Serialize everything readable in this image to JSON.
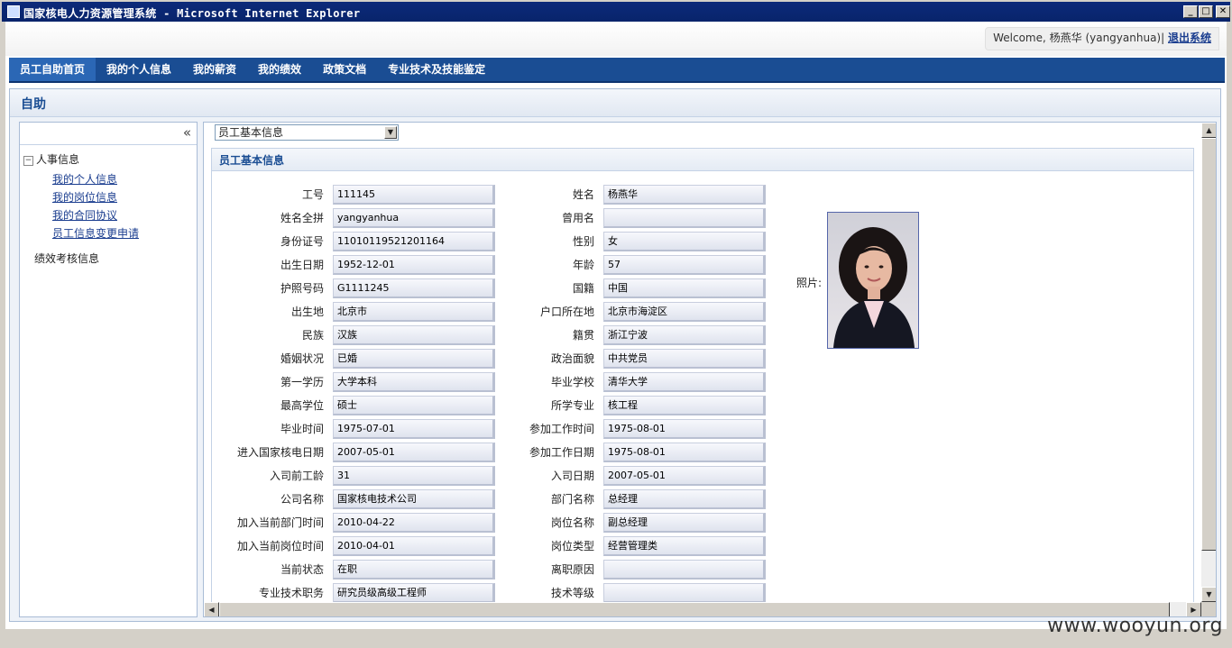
{
  "window": {
    "title": "国家核电人力资源管理系统 - Microsoft Internet Explorer"
  },
  "header": {
    "welcome": "Welcome, 杨燕华 (yangyanhua)|",
    "logout": "退出系统"
  },
  "nav": {
    "items": [
      "员工自助首页",
      "我的个人信息",
      "我的薪资",
      "我的绩效",
      "政策文档",
      "专业技术及技能鉴定"
    ],
    "active_index": 0
  },
  "panel": {
    "title": "自助"
  },
  "sidebar": {
    "collapse_glyph": "«",
    "groups": [
      {
        "label": "人事信息",
        "expanded": true,
        "links": [
          "我的个人信息",
          "我的岗位信息",
          "我的合同协议",
          "员工信息变更申请"
        ]
      },
      {
        "label": "绩效考核信息",
        "expanded": false,
        "links": []
      }
    ]
  },
  "content": {
    "select": {
      "value": "员工基本信息"
    },
    "section_title": "员工基本信息",
    "left_fields": [
      {
        "label": "工号",
        "value": "111145"
      },
      {
        "label": "姓名全拼",
        "value": "yangyanhua"
      },
      {
        "label": "身份证号",
        "value": "11010119521201164"
      },
      {
        "label": "出生日期",
        "value": "1952-12-01"
      },
      {
        "label": "护照号码",
        "value": "G1111245"
      },
      {
        "label": "出生地",
        "value": "北京市"
      },
      {
        "label": "民族",
        "value": "汉族"
      },
      {
        "label": "婚姻状况",
        "value": "已婚"
      },
      {
        "label": "第一学历",
        "value": "大学本科"
      },
      {
        "label": "最高学位",
        "value": "硕士"
      },
      {
        "label": "毕业时间",
        "value": "1975-07-01"
      },
      {
        "label": "进入国家核电日期",
        "value": "2007-05-01"
      },
      {
        "label": "入司前工龄",
        "value": "31"
      },
      {
        "label": "公司名称",
        "value": "国家核电技术公司"
      },
      {
        "label": "加入当前部门时间",
        "value": "2010-04-22"
      },
      {
        "label": "加入当前岗位时间",
        "value": "2010-04-01"
      },
      {
        "label": "当前状态",
        "value": "在职"
      },
      {
        "label": "专业技术职务",
        "value": "研究员级高级工程师"
      }
    ],
    "right_fields": [
      {
        "label": "姓名",
        "value": "杨燕华"
      },
      {
        "label": "曾用名",
        "value": ""
      },
      {
        "label": "性别",
        "value": "女"
      },
      {
        "label": "年龄",
        "value": "57"
      },
      {
        "label": "国籍",
        "value": "中国"
      },
      {
        "label": "户口所在地",
        "value": "北京市海淀区"
      },
      {
        "label": "籍贯",
        "value": "浙江宁波"
      },
      {
        "label": "政治面貌",
        "value": "中共党员"
      },
      {
        "label": "毕业学校",
        "value": "清华大学"
      },
      {
        "label": "所学专业",
        "value": "核工程"
      },
      {
        "label": "参加工作时间",
        "value": "1975-08-01"
      },
      {
        "label": "参加工作日期",
        "value": "1975-08-01"
      },
      {
        "label": "入司日期",
        "value": "2007-05-01"
      },
      {
        "label": "部门名称",
        "value": "总经理"
      },
      {
        "label": "岗位名称",
        "value": "副总经理"
      },
      {
        "label": "岗位类型",
        "value": "经营管理类"
      },
      {
        "label": "离职原因",
        "value": ""
      },
      {
        "label": "技术等级",
        "value": ""
      }
    ],
    "photo_label": "照片:"
  },
  "watermark": "www.wooyun.org"
}
